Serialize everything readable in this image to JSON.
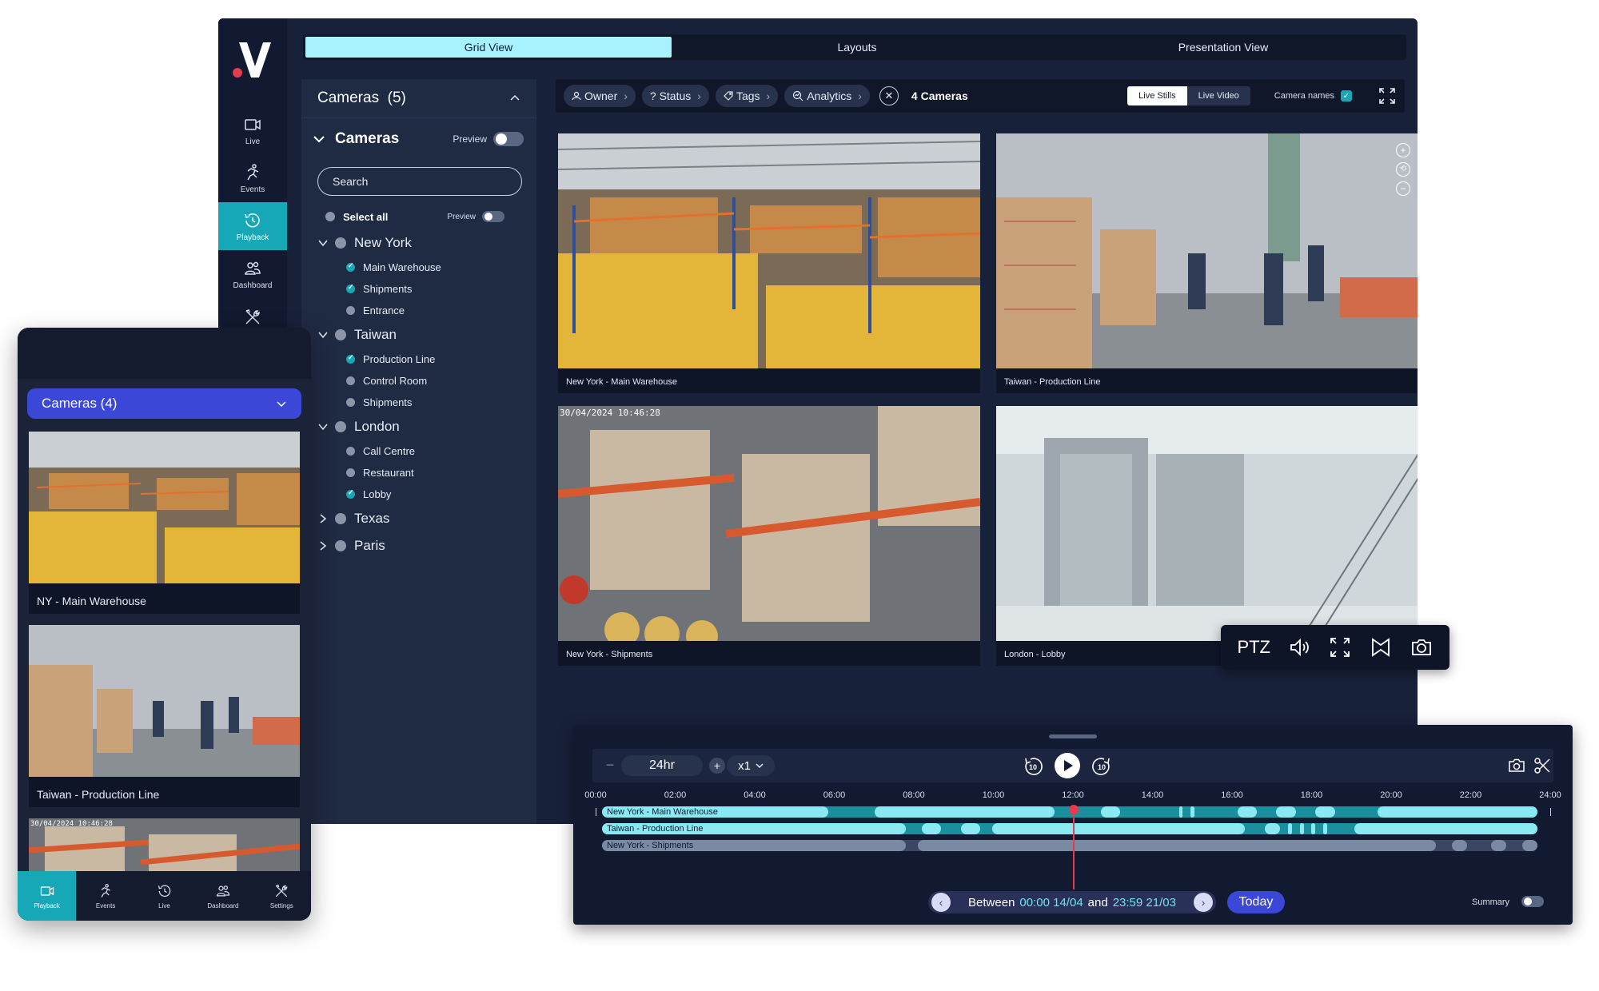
{
  "rail": {
    "items": [
      {
        "label": "Live",
        "icon": "video-icon"
      },
      {
        "label": "Events",
        "icon": "person-run-icon"
      },
      {
        "label": "Playback",
        "icon": "history-icon"
      },
      {
        "label": "Dashboard",
        "icon": "users-icon"
      },
      {
        "label": "",
        "icon": "tools-icon"
      }
    ]
  },
  "top_tabs": [
    "Grid View",
    "Layouts",
    "Presentation View"
  ],
  "cam_panel": {
    "header": "Cameras  (5)",
    "sub_title": "Cameras",
    "preview_label": "Preview",
    "search_placeholder": "Search",
    "select_all": "Select all",
    "select_all_preview": "Preview",
    "groups": [
      {
        "name": "New York",
        "expanded": true,
        "children": [
          {
            "name": "Main Warehouse",
            "checked": true
          },
          {
            "name": "Shipments",
            "checked": true
          },
          {
            "name": "Entrance",
            "checked": false
          }
        ]
      },
      {
        "name": "Taiwan",
        "expanded": true,
        "children": [
          {
            "name": "Production Line",
            "checked": true
          },
          {
            "name": "Control Room",
            "checked": false
          },
          {
            "name": "Shipments",
            "checked": false
          }
        ]
      },
      {
        "name": "London",
        "expanded": true,
        "children": [
          {
            "name": "Call Centre",
            "checked": false
          },
          {
            "name": "Restaurant",
            "checked": false
          },
          {
            "name": "Lobby",
            "checked": true
          }
        ]
      },
      {
        "name": "Texas",
        "expanded": false,
        "children": []
      },
      {
        "name": "Paris",
        "expanded": false,
        "children": []
      }
    ]
  },
  "filters": {
    "chips": [
      "Owner",
      "? Status",
      "Tags",
      "Analytics"
    ],
    "count": "4 Cameras",
    "view_options": [
      "Live Stills",
      "Live Video"
    ],
    "camera_names_label": "Camera names"
  },
  "tiles": [
    {
      "caption": "New York - Main Warehouse",
      "osd": ""
    },
    {
      "caption": "Taiwan - Production Line",
      "osd": ""
    },
    {
      "caption": "New York - Shipments",
      "osd": "30/04/2024 10:46:28"
    },
    {
      "caption": "London - Lobby",
      "osd": ""
    }
  ],
  "ptz": {
    "label": "PTZ"
  },
  "timeline": {
    "zoom": "24hr",
    "speed": "x1",
    "skip_back": "10",
    "skip_forward": "10",
    "ticks": [
      "00:00",
      "02:00",
      "04:00",
      "06:00",
      "08:00",
      "10:00",
      "12:00",
      "14:00",
      "16:00",
      "18:00",
      "20:00",
      "22:00",
      "24:00"
    ],
    "playhead_hour": 12,
    "tracks": [
      {
        "label": "New York - Main Warehouse",
        "color": "#1a8f9e",
        "seg_color": "#8aeaf4",
        "segments": [
          [
            0.0,
            5.8
          ],
          [
            7.0,
            11.6
          ],
          [
            12.8,
            13.3
          ],
          [
            14.8,
            14.9
          ],
          [
            15.1,
            15.2
          ],
          [
            16.3,
            16.8
          ],
          [
            17.3,
            17.8
          ],
          [
            18.3,
            18.8
          ],
          [
            19.9,
            24.0
          ]
        ]
      },
      {
        "label": "Taiwan - Production Line",
        "color": "#1a8f9e",
        "seg_color": "#8aeaf4",
        "segments": [
          [
            0.0,
            7.8
          ],
          [
            8.2,
            8.7
          ],
          [
            9.2,
            9.7
          ],
          [
            10.0,
            16.5
          ],
          [
            17.0,
            17.4
          ],
          [
            17.6,
            17.7
          ],
          [
            17.9,
            18.0
          ],
          [
            18.2,
            18.3
          ],
          [
            18.5,
            18.6
          ],
          [
            19.3,
            24.0
          ]
        ]
      },
      {
        "label": "New York - Shipments",
        "color": "#3a4663",
        "seg_color": "#7a8aa3",
        "segments": [
          [
            0.0,
            7.8
          ],
          [
            8.1,
            21.4
          ],
          [
            21.8,
            22.2
          ],
          [
            22.8,
            23.2
          ],
          [
            23.6,
            24.0
          ]
        ]
      }
    ],
    "range": {
      "prefix": "Between",
      "start": "00:00 14/04",
      "mid": "and",
      "end": "23:59 21/03"
    },
    "today": "Today",
    "summary": "Summary"
  },
  "mobile": {
    "cams_label": "Cameras (4)",
    "tiles": [
      {
        "caption": "NY - Main Warehouse",
        "osd": ""
      },
      {
        "caption": "Taiwan - Production Line",
        "osd": ""
      },
      {
        "caption": "",
        "osd": "30/04/2024 10:46:28"
      }
    ],
    "nav": [
      "Playback",
      "Events",
      "Live",
      "Dashboard",
      "Settings"
    ]
  },
  "colors": {
    "accent": "#17a8b8",
    "brand_red": "#e53b4e",
    "primary_blue": "#3b47d6",
    "bg": "#18213a"
  }
}
